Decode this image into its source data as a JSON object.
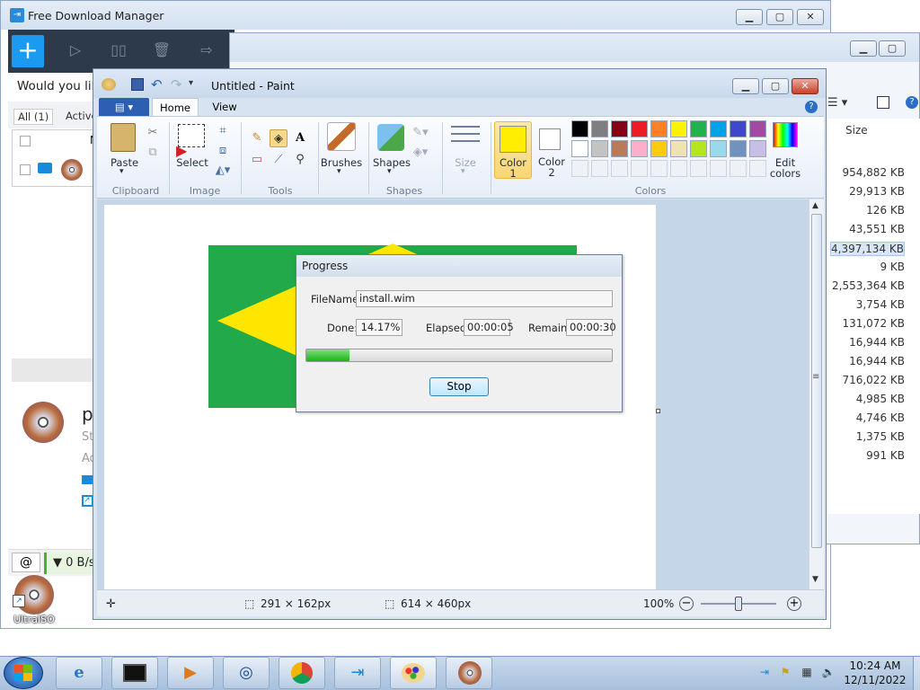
{
  "fdm": {
    "title": "Free Download Manager",
    "banner": "Would you like",
    "tabs": [
      "All (1)",
      "Active"
    ],
    "list_col": "N",
    "detail_name": "pr",
    "detail_line1": "St",
    "detail_line2": "Ad",
    "speed": "0 B/s"
  },
  "explorer": {
    "size_header": "Size",
    "sizes": [
      "954,882 KB",
      "29,913 KB",
      "126 KB",
      "43,551 KB",
      "4,397,134 KB",
      "9 KB",
      "2,553,364 KB",
      "3,754 KB",
      "131,072 KB",
      "16,944 KB",
      "16,944 KB",
      "716,022 KB",
      "4,985 KB",
      "4,746 KB",
      "1,375 KB",
      "991 KB"
    ],
    "selected_index": 4
  },
  "paint": {
    "title": "Untitled - Paint",
    "tabs": {
      "home": "Home",
      "view": "View"
    },
    "groups": {
      "clipboard": "Clipboard",
      "image": "Image",
      "tools": "Tools",
      "shapes": "Shapes",
      "colors": "Colors"
    },
    "labels": {
      "paste": "Paste",
      "select": "Select",
      "brushes": "Brushes",
      "shapes": "Shapes",
      "size": "Size",
      "color1": "Color 1",
      "color1_a": "Color",
      "color1_b": "1",
      "color2_a": "Color",
      "color2_b": "2",
      "edit_colors_a": "Edit",
      "edit_colors_b": "colors"
    },
    "color1": "#ffee00",
    "color2": "#ffffff",
    "palette_row1": [
      "#000000",
      "#7f7f7f",
      "#880015",
      "#ed1c24",
      "#ff7f27",
      "#fff200",
      "#22b14c",
      "#00a2e8",
      "#3f48cc",
      "#a349a4"
    ],
    "palette_row2": [
      "#ffffff",
      "#c3c3c3",
      "#b97a57",
      "#ffaec9",
      "#ffc90e",
      "#efe4b0",
      "#b5e61d",
      "#99d9ea",
      "#7092be",
      "#c8bfe7"
    ],
    "status": {
      "selection": "291 × 162px",
      "canvas_size": "614 × 460px",
      "zoom": "100%"
    }
  },
  "progress": {
    "title": "Progress",
    "filename_label": "FileName:",
    "filename": "install.wim",
    "done_label": "Done:",
    "done": "14.17%",
    "elapsed_label": "Elapsed:",
    "elapsed": "00:00:05",
    "remain_label": "Remain:",
    "remain": "00:00:30",
    "progress_fraction": 0.1417,
    "stop_label": "Stop"
  },
  "desktop": {
    "icon_label": "UltraISO"
  },
  "taskbar": {
    "time": "10:24 AM",
    "date": "12/11/2022",
    "apps": [
      "ie-icon",
      "console-icon",
      "media-player-icon",
      "network-icon",
      "chrome-icon",
      "fdm-icon",
      "paint-icon",
      "ultraiso-icon"
    ]
  }
}
